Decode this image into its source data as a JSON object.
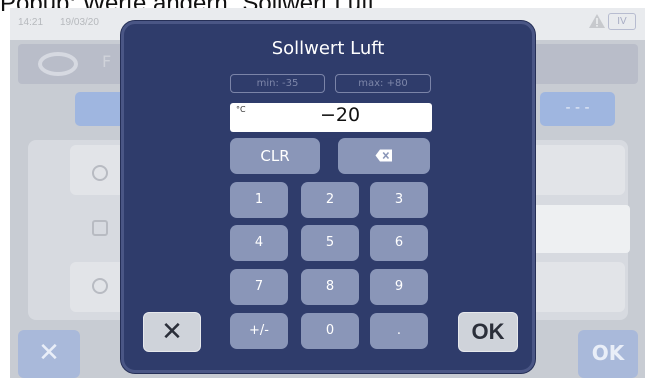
{
  "caption": "Popup: Werte ändern „Sollwert Luft“",
  "background": {
    "time": "14:21",
    "date": "19/03/20",
    "header_text": "F",
    "level_badge": "IV",
    "right_pill_label": "- - -",
    "cancel_symbol": "✕",
    "ok_label": "OK"
  },
  "dialog": {
    "title": "Sollwert Luft",
    "min_label": "min: -35",
    "max_label": "max: +80",
    "unit": "°C",
    "value": "−20",
    "clear_label": "CLR",
    "backspace_icon": "backspace-icon",
    "keys": {
      "k1": "1",
      "k2": "2",
      "k3": "3",
      "k4": "4",
      "k5": "5",
      "k6": "6",
      "k7": "7",
      "k8": "8",
      "k9": "9",
      "sign": "+/-",
      "k0": "0",
      "dot": "."
    },
    "cancel_symbol": "✕",
    "ok_label": "OK"
  },
  "colors": {
    "dialog_bg": "#2f3c6b",
    "key_bg": "#8a96b8",
    "action_bg": "#cfd3da"
  }
}
